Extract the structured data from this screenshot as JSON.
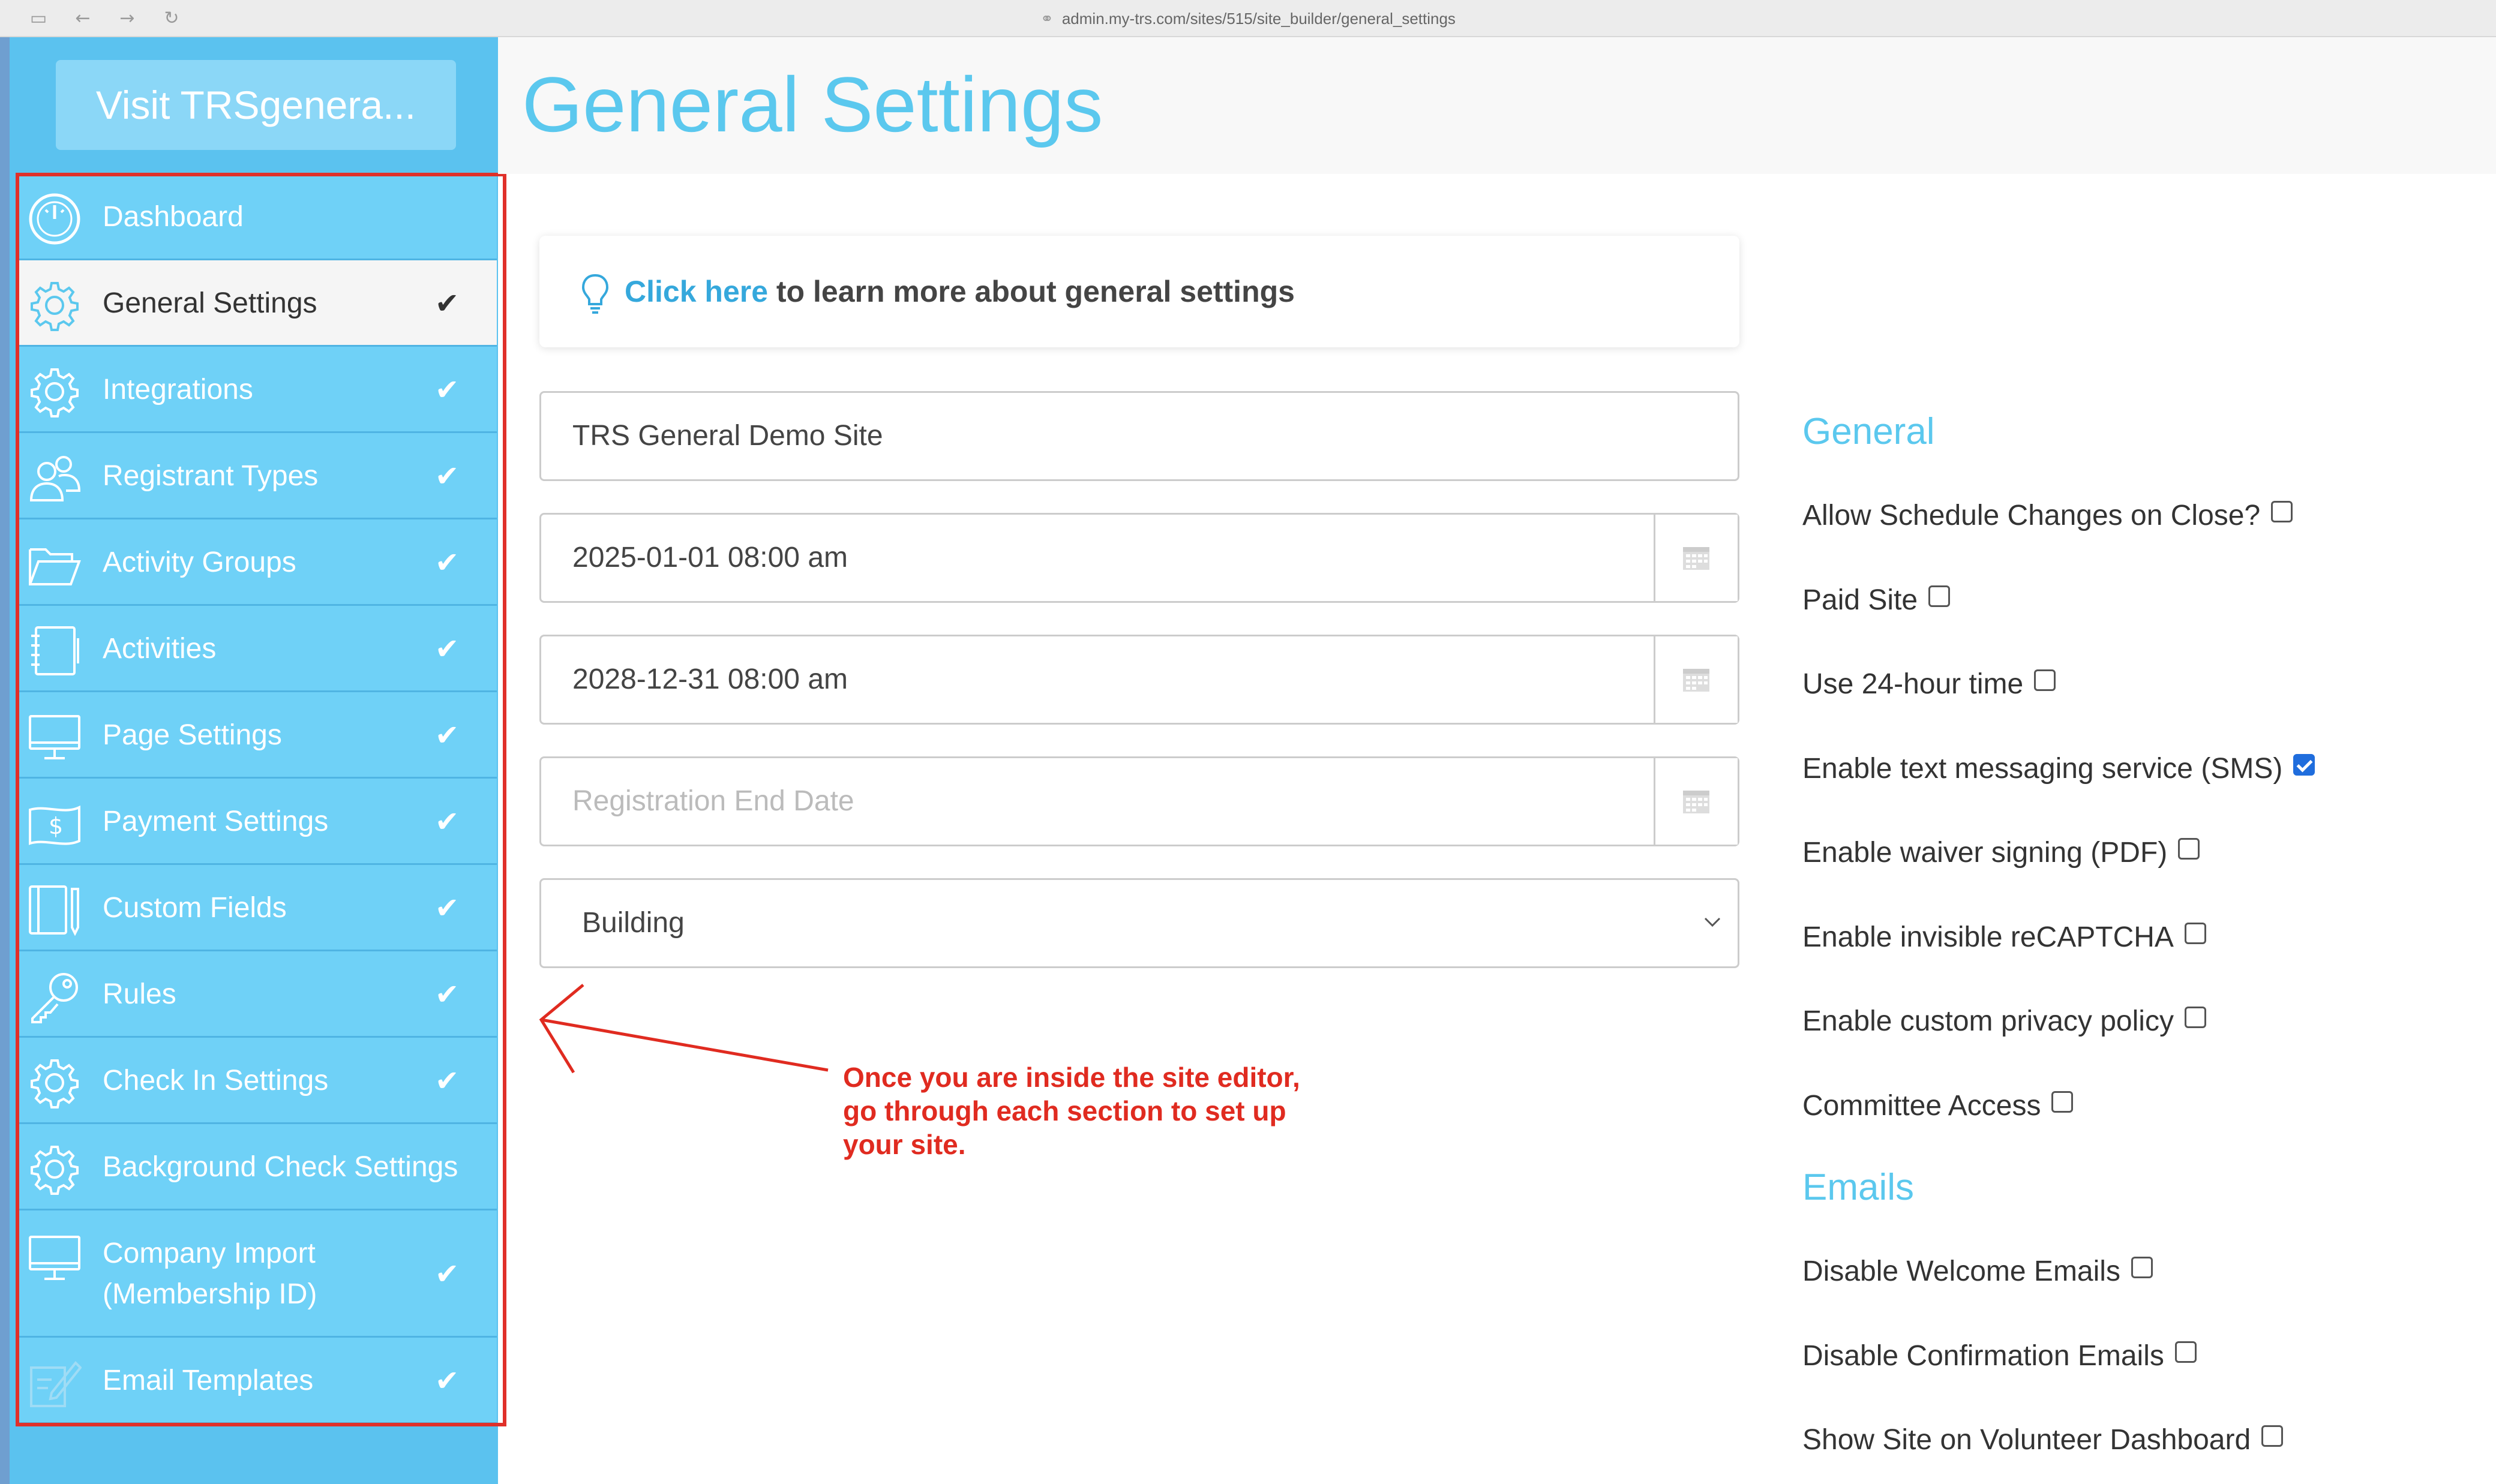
{
  "browser": {
    "url": "admin.my-trs.com/sites/515/site_builder/general_settings"
  },
  "sidebar": {
    "visit_button": "Visit TRSgenera...",
    "items": [
      {
        "label": "Dashboard",
        "icon": "dashboard-gauge-icon",
        "checked": false,
        "active": false
      },
      {
        "label": "General Settings",
        "icon": "gear-icon",
        "checked": true,
        "active": true
      },
      {
        "label": "Integrations",
        "icon": "gear-icon",
        "checked": true,
        "active": false
      },
      {
        "label": "Registrant Types",
        "icon": "people-icon",
        "checked": true,
        "active": false
      },
      {
        "label": "Activity Groups",
        "icon": "folder-icon",
        "checked": true,
        "active": false
      },
      {
        "label": "Activities",
        "icon": "notebook-icon",
        "checked": true,
        "active": false
      },
      {
        "label": "Page Settings",
        "icon": "monitor-icon",
        "checked": true,
        "active": false
      },
      {
        "label": "Payment Settings",
        "icon": "money-icon",
        "checked": true,
        "active": false
      },
      {
        "label": "Custom Fields",
        "icon": "book-pencil-icon",
        "checked": true,
        "active": false
      },
      {
        "label": "Rules",
        "icon": "key-icon",
        "checked": true,
        "active": false
      },
      {
        "label": "Check In Settings",
        "icon": "gear-icon",
        "checked": true,
        "active": false
      },
      {
        "label": "Background Check Settings",
        "icon": "gear-icon",
        "checked": true,
        "active": false
      },
      {
        "label_line1": "Company Import",
        "label_line2": "(Membership ID)",
        "icon": "monitor-icon",
        "checked": true,
        "active": false
      },
      {
        "label": "Email Templates",
        "icon": "edit-document-icon",
        "checked": true,
        "active": false
      }
    ],
    "check_glyph": "✔"
  },
  "header": {
    "title": "General Settings"
  },
  "info": {
    "link_text": "Click here",
    "rest_text": " to learn more about general settings"
  },
  "form": {
    "site_name": "TRS General Demo Site",
    "start_date": "2025-01-01 08:00 am",
    "end_date": "2028-12-31 08:00 am",
    "registration_end_placeholder": "Registration End Date",
    "status_select": "Building"
  },
  "annotation": {
    "line1": "Once you are inside the site editor,",
    "line2": "go through each section to set up",
    "line3": "your site."
  },
  "settings": {
    "general_heading": "General",
    "general_options": [
      {
        "label": "Allow Schedule Changes on Close?",
        "checked": false
      },
      {
        "label": "Paid Site",
        "checked": false
      },
      {
        "label": "Use 24-hour time",
        "checked": false
      },
      {
        "label": "Enable text messaging service (SMS)",
        "checked": true
      },
      {
        "label": "Enable waiver signing (PDF)",
        "checked": false
      },
      {
        "label": "Enable invisible reCAPTCHA",
        "checked": false
      },
      {
        "label": "Enable custom privacy policy",
        "checked": false
      },
      {
        "label": "Committee Access",
        "checked": false
      }
    ],
    "emails_heading": "Emails",
    "email_options": [
      {
        "label": "Disable Welcome Emails",
        "checked": false
      },
      {
        "label": "Disable Confirmation Emails",
        "checked": false
      },
      {
        "label": "Show Site on Volunteer Dashboard",
        "checked": false
      }
    ]
  },
  "colors": {
    "accent": "#5bc8ee",
    "sidebar_bg": "#5bc2ef",
    "nav_item_bg": "#6fd1f7",
    "annotation_red": "#e02b20",
    "checkbox_checked": "#1f6ddd"
  }
}
